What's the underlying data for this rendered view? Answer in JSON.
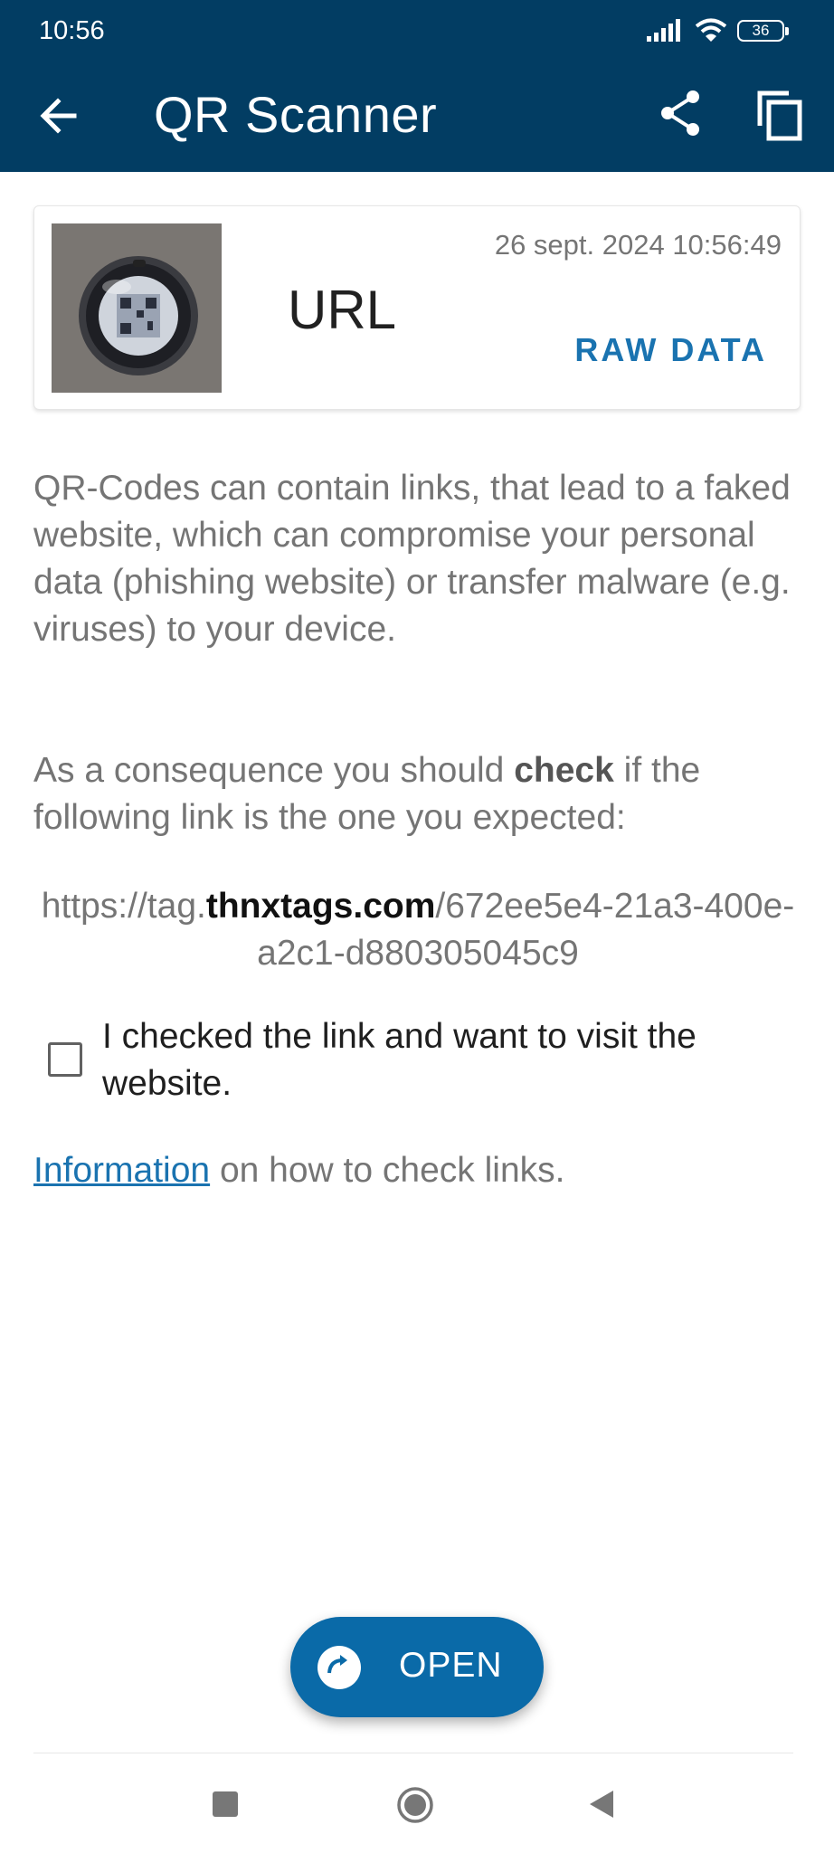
{
  "status_bar": {
    "time": "10:56",
    "battery": "36"
  },
  "app_bar": {
    "title": "QR Scanner"
  },
  "icons": {
    "back": "arrow-back-icon",
    "share": "share-icon",
    "copy": "copy-icon",
    "signal": "cell-signal-icon",
    "wifi": "wifi-icon",
    "fab": "open-link-icon"
  },
  "card": {
    "timestamp": "26 sept. 2024 10:56:49",
    "type": "URL",
    "raw_data_label": "RAW DATA"
  },
  "warning": {
    "paragraph1": "QR-Codes can contain links, that lead to a faked website, which can compromise your personal data (phishing website) or transfer malware (e.g. viruses) to your device.",
    "paragraph2_prefix": "As a consequence you should ",
    "paragraph2_bold": "check",
    "paragraph2_suffix": " if the following link is the one you expected:"
  },
  "link": {
    "prefix": "https://tag.",
    "domain": "thnxtags.com",
    "path": "/672ee5e4-21a3-400e-a2c1-d880305045c9"
  },
  "confirm": {
    "label": "I checked the link and want to visit the website.",
    "checked": false
  },
  "info": {
    "link_label": "Information",
    "suffix": " on how to check links."
  },
  "fab": {
    "label": "OPEN"
  },
  "colors": {
    "app_bar": "#023d63",
    "accent": "#1a73b0",
    "fab": "#0a6aa8"
  }
}
